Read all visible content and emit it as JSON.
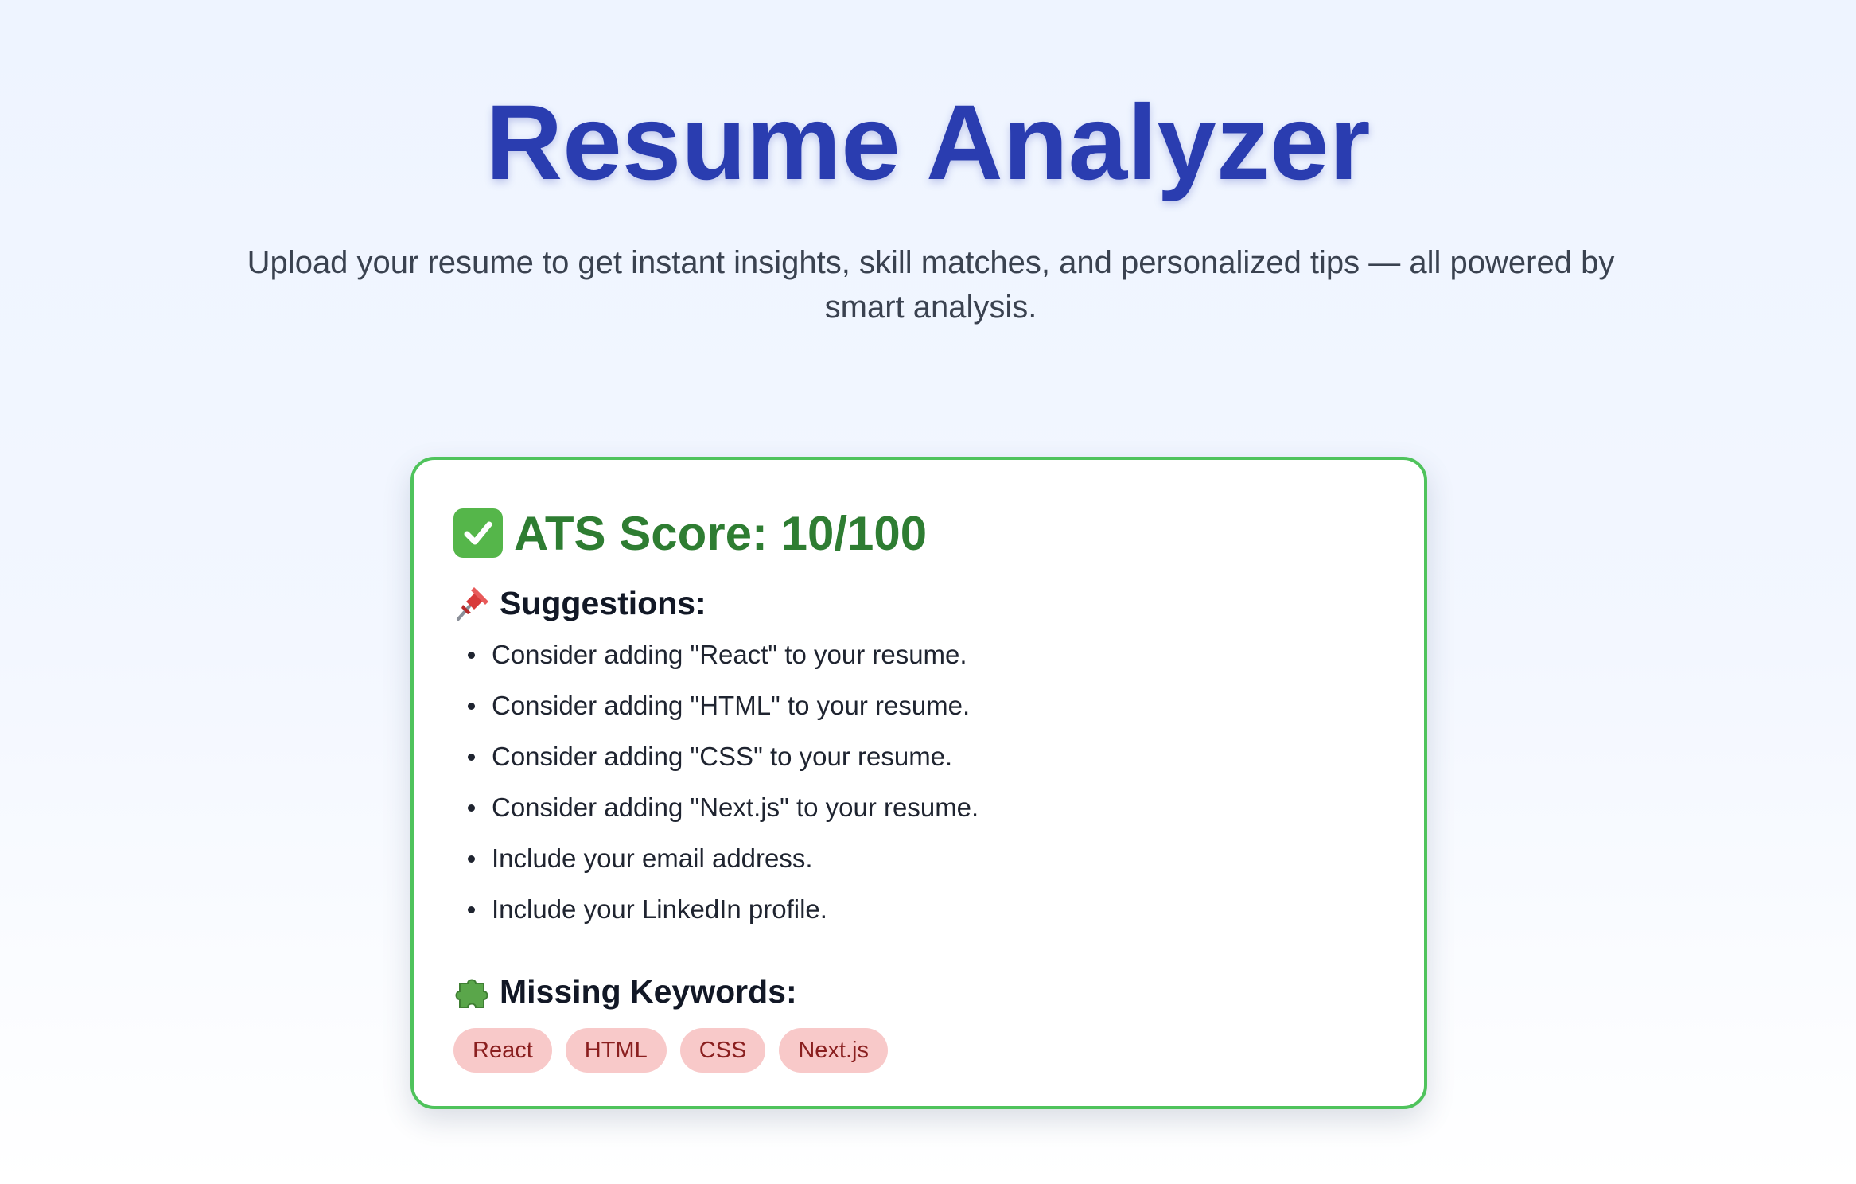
{
  "header": {
    "title": "Resume Analyzer",
    "subtitle": "Upload your resume to get instant insights, skill matches, and personalized tips — all powered by smart analysis."
  },
  "result": {
    "score_label": "ATS Score: 10/100",
    "score_value": 10,
    "score_max": 100,
    "score_icon": "check-mark-button-icon",
    "suggestions_title": "Suggestions:",
    "suggestions_icon": "pushpin-icon",
    "suggestions": [
      "Consider adding \"React\" to your resume.",
      "Consider adding \"HTML\" to your resume.",
      "Consider adding \"CSS\" to your resume.",
      "Consider adding \"Next.js\" to your resume.",
      "Include your email address.",
      "Include your LinkedIn profile."
    ],
    "keywords_title": "Missing Keywords:",
    "keywords_icon": "puzzle-piece-icon",
    "missing_keywords": [
      "React",
      "HTML",
      "CSS",
      "Next.js"
    ]
  },
  "colors": {
    "title": "#2a3db0",
    "score": "#2e7d32",
    "card_border": "#4fc35c",
    "chip_background": "#f8c9c9",
    "chip_text": "#8a1f1f"
  }
}
